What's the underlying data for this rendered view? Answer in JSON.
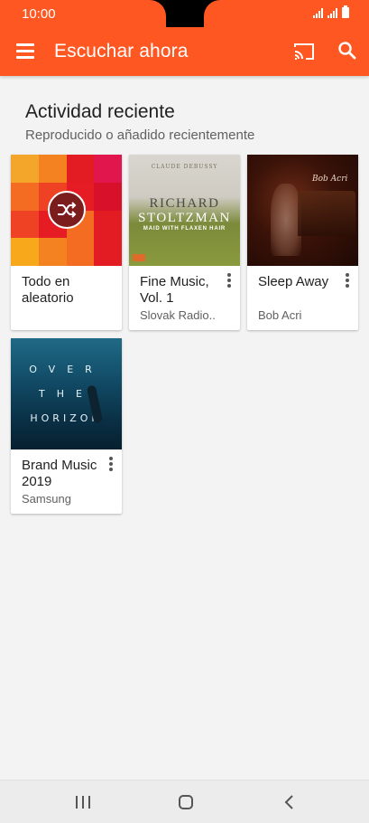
{
  "status_bar": {
    "time": "10:00"
  },
  "app_bar": {
    "title": "Escuchar ahora",
    "menu_icon": "hamburger-menu-icon",
    "cast_icon": "cast-icon",
    "search_icon": "search-icon",
    "color": "#ff5722"
  },
  "section": {
    "title": "Actividad reciente",
    "subtitle": "Reproducido o añadido recientemente"
  },
  "cards": [
    {
      "title": "Todo en aleatorio",
      "artist": "",
      "has_menu": false,
      "art": "shuffle-grid"
    },
    {
      "title": "Fine Music, Vol. 1",
      "artist": "Slovak Radio..",
      "has_menu": true,
      "art": "album-art-richard-stoltzman",
      "art_text": {
        "composer": "CLAUDE DEBUSSY",
        "line1": "RICHARD",
        "line2": "STOLTZMAN",
        "line3": "MAID WITH FLAXEN HAIR"
      }
    },
    {
      "title": "Sleep Away",
      "artist": "Bob Acri",
      "has_menu": true,
      "art": "album-art-bob-acri",
      "art_text": {
        "line1": "Bob Acri"
      }
    },
    {
      "title": "Brand Music 2019",
      "artist": "Samsung",
      "has_menu": true,
      "art": "album-art-over-the-horizon",
      "art_text": {
        "line1": "OVER",
        "line2": "THE",
        "line3": "HORIZON"
      }
    }
  ],
  "nav_bar": {
    "recent_icon": "recent-apps-icon",
    "home_icon": "home-icon",
    "back_icon": "back-icon"
  }
}
